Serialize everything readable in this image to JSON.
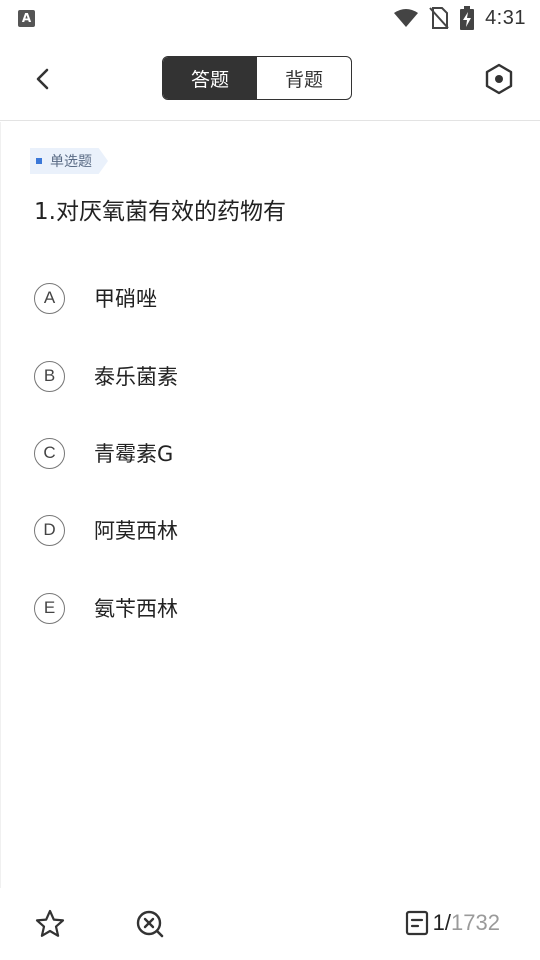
{
  "status_bar": {
    "app_icon_letter": "A",
    "time": "4:31"
  },
  "header": {
    "tabs": [
      {
        "label": "答题",
        "active": true
      },
      {
        "label": "背题",
        "active": false
      }
    ]
  },
  "question": {
    "type_label": "单选题",
    "title": "1.对厌氧菌有效的药物有",
    "options": [
      {
        "letter": "A",
        "text": "甲硝唑"
      },
      {
        "letter": "B",
        "text": "泰乐菌素"
      },
      {
        "letter": "C",
        "text": "青霉素G"
      },
      {
        "letter": "D",
        "text": "阿莫西林"
      },
      {
        "letter": "E",
        "text": "氨苄西林"
      }
    ]
  },
  "bottom_bar": {
    "current": "1",
    "separator": "/",
    "total": "1732",
    "icons": [
      "star-icon",
      "delete-circle-icon",
      "answer-sheet-icon"
    ]
  },
  "colors": {
    "accent_dark": "#333333",
    "tag_bg": "#eaf1fb",
    "tag_dot": "#3b78d8",
    "muted": "#9a9a9a"
  }
}
